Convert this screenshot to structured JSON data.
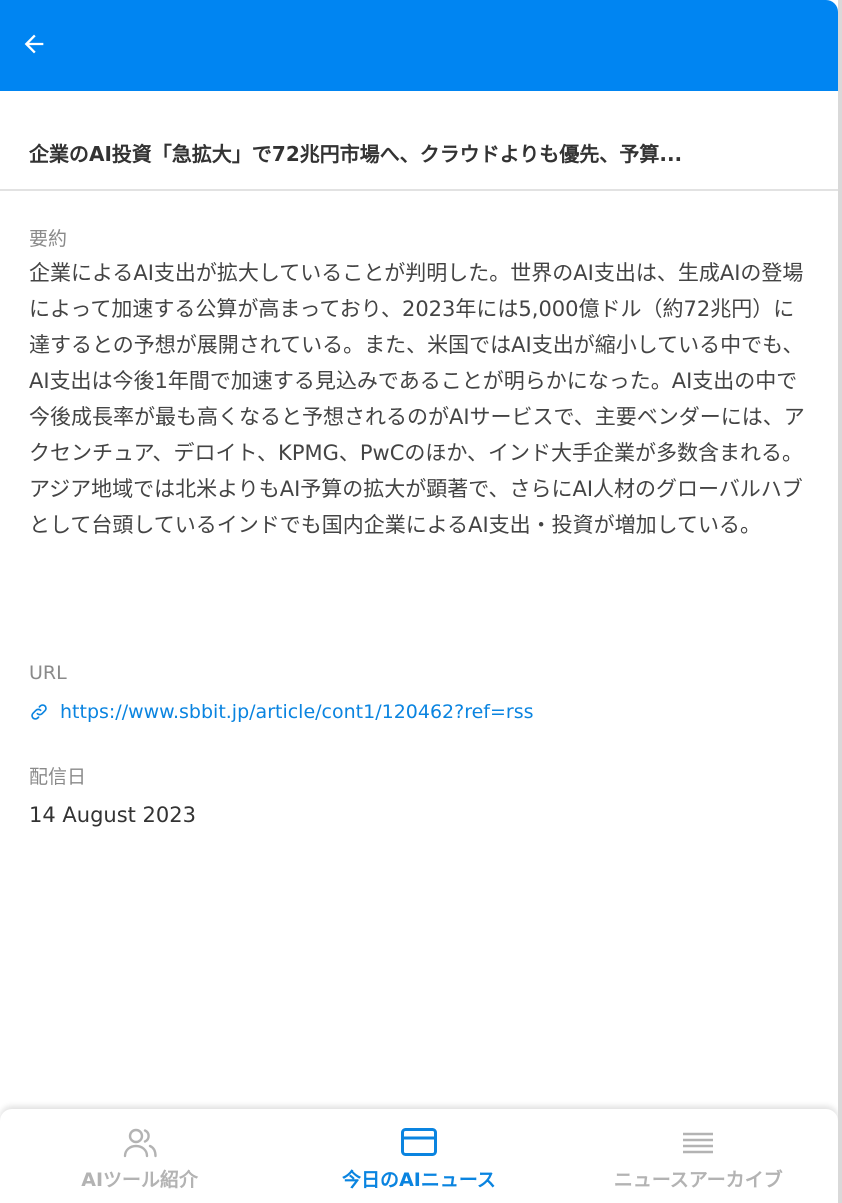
{
  "header": {
    "back_icon": "arrow-left-icon",
    "bar_color": "#0085f2"
  },
  "article": {
    "title": "企業のAI投資「急拡大」で72兆円市場へ、クラウドよりも優先、予算...",
    "summary_label": "要約",
    "summary": "企業によるAI支出が拡大していることが判明した。世界のAI支出は、生成AIの登場によって加速する公算が高まっており、2023年には5,000億ドル（約72兆円）に達するとの予想が展開されている。また、米国ではAI支出が縮小している中でも、AI支出は今後1年間で加速する見込みであることが明らかになった。AI支出の中で今後成長率が最も高くなると予想されるのがAIサービスで、主要ベンダーには、アクセンチュア、デロイト、KPMG、PwCのほか、インド大手企業が多数含まれる。アジア地域では北米よりもAI予算の拡大が顕著で、さらにAI人材のグローバルハブとして台頭しているインドでも国内企業によるAI支出・投資が増加している。",
    "url_label": "URL",
    "url": "https://www.sbbit.jp/article/cont1/120462?ref=rss",
    "url_icon": "link-icon",
    "date_label": "配信日",
    "date": "14 August 2023"
  },
  "bottom_nav": {
    "items": [
      {
        "label": "AIツール紹介",
        "icon": "users-icon",
        "active": false
      },
      {
        "label": "今日のAIニュース",
        "icon": "card-icon",
        "active": true
      },
      {
        "label": "ニュースアーカイブ",
        "icon": "list-icon",
        "active": false
      }
    ],
    "active_color": "#0a84e0",
    "inactive_color": "#b3b3b3"
  }
}
